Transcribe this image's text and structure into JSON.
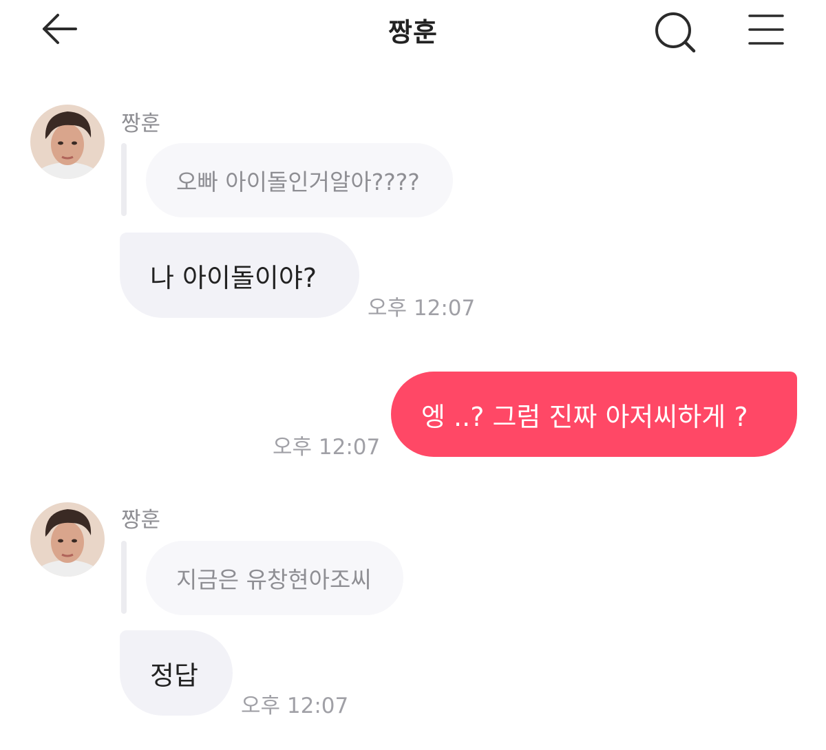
{
  "header": {
    "title": "짱훈",
    "back_icon": "back-arrow-icon",
    "search_icon": "search-icon",
    "menu_icon": "hamburger-menu-icon"
  },
  "messages": [
    {
      "sender": "짱훈",
      "quoted": "오빠 아이돌인거알아????",
      "text": "나 아이돌이야?",
      "time": "오후 12:07"
    },
    {
      "sender": "me",
      "text": "엥 ..? 그럼 진짜 아저씨하게 ?",
      "time": "오후 12:07"
    },
    {
      "sender": "짱훈",
      "quoted": "지금은 유창현아조씨",
      "text": "정답",
      "time": "오후 12:07"
    }
  ],
  "colors": {
    "outgoing_bubble": "#ff4866",
    "incoming_bubble": "#f2f2f7",
    "quoted_bubble": "#f7f7fa",
    "meta_text": "#a0a0a6"
  }
}
